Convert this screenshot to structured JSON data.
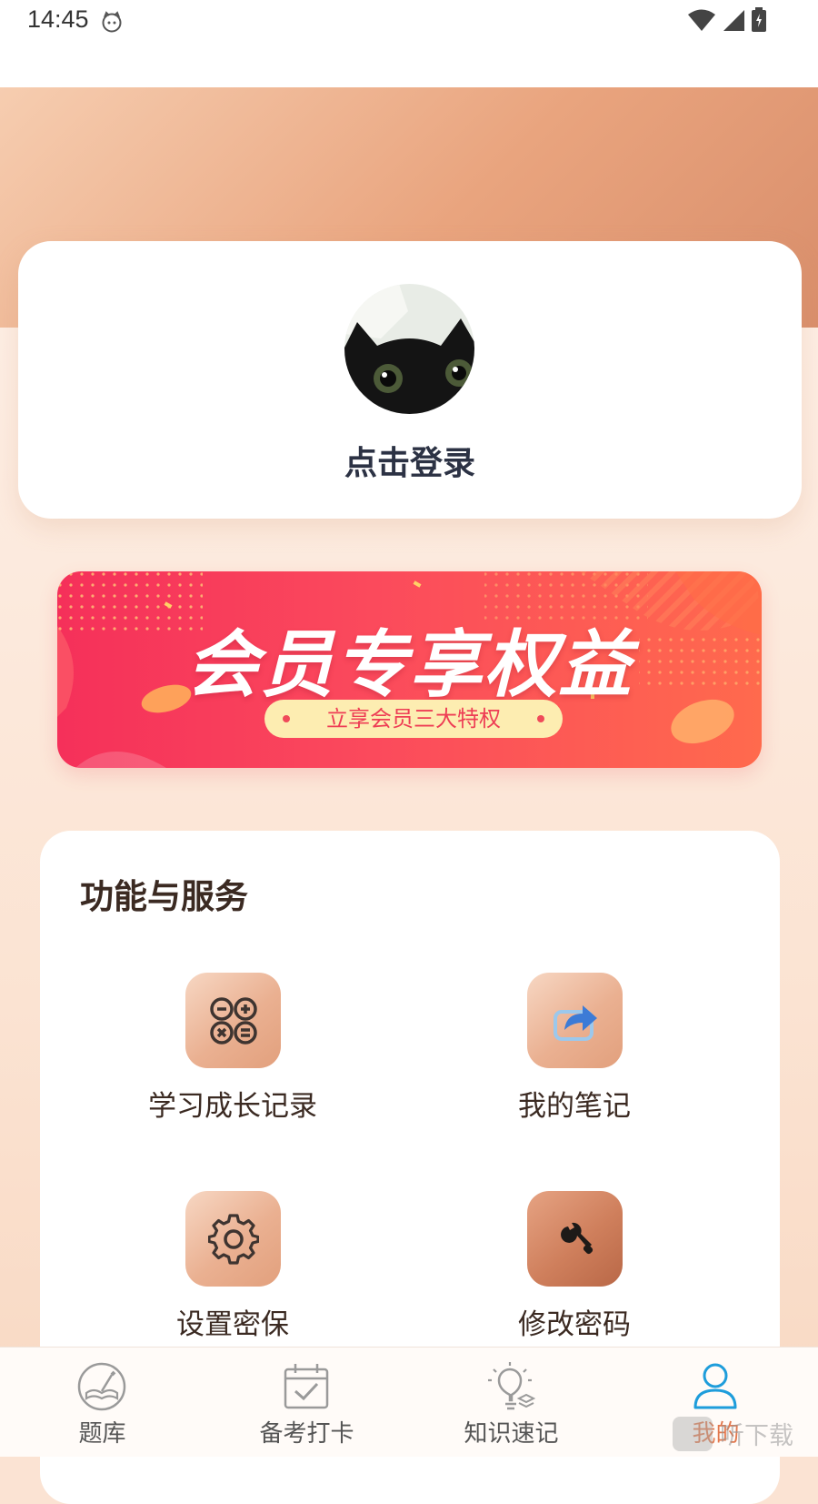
{
  "status_bar": {
    "time": "14:45"
  },
  "profile": {
    "login_prompt": "点击登录"
  },
  "banner": {
    "title": "会员专享权益",
    "subtitle": "立享会员三大特权"
  },
  "services": {
    "title": "功能与服务",
    "items": [
      {
        "label": "学习成长记录",
        "icon": "calculator-icon"
      },
      {
        "label": "我的笔记",
        "icon": "share-icon"
      },
      {
        "label": "设置密保",
        "icon": "gear-icon"
      },
      {
        "label": "修改密码",
        "icon": "wrench-icon"
      }
    ]
  },
  "tabbar": {
    "items": [
      {
        "label": "题库",
        "icon": "book-quill-icon",
        "active": false
      },
      {
        "label": "备考打卡",
        "icon": "calendar-check-icon",
        "active": false
      },
      {
        "label": "知识速记",
        "icon": "lightbulb-icon",
        "active": false
      },
      {
        "label": "我的",
        "icon": "person-icon",
        "active": true
      }
    ]
  },
  "watermark": {
    "text": "听下载"
  },
  "colors": {
    "accent": "#e2784e",
    "active_icon": "#1e9ddb",
    "banner": "#f5305a"
  }
}
